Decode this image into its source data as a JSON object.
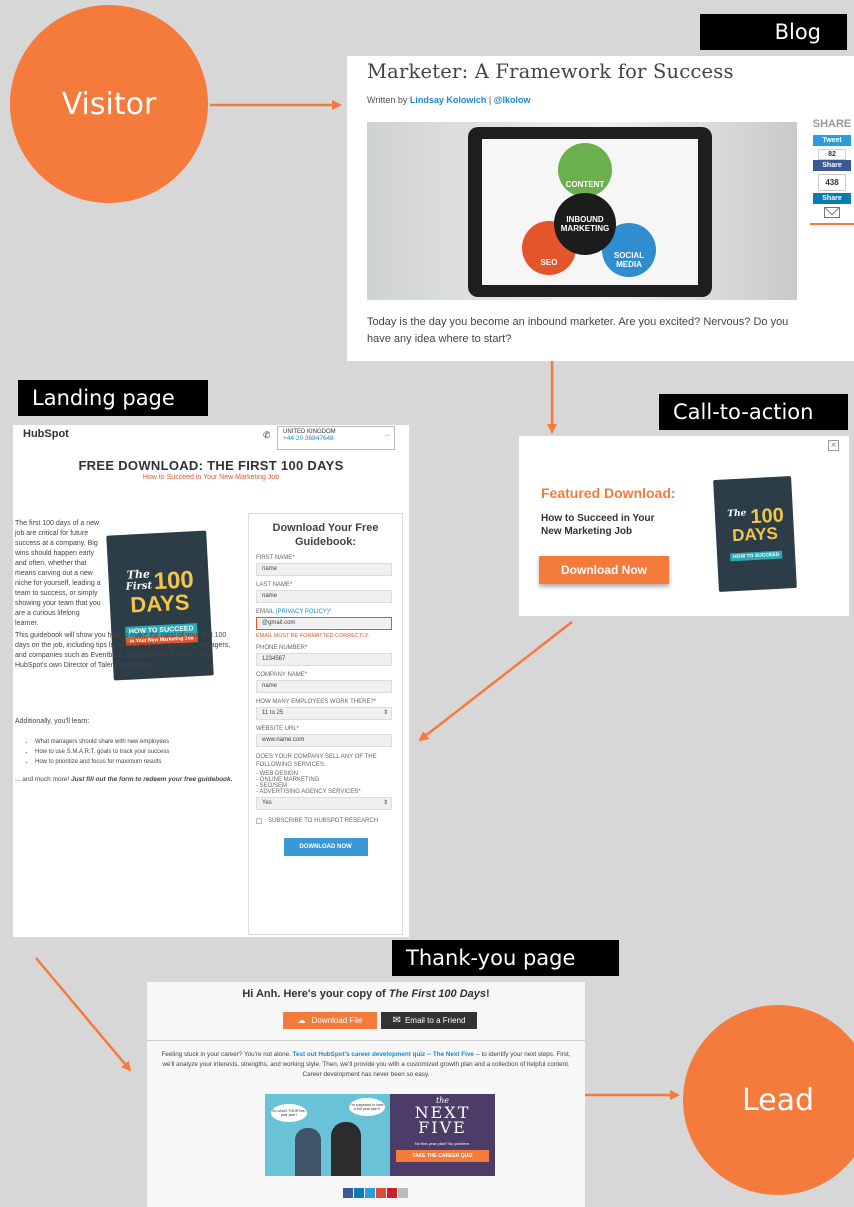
{
  "nodes": {
    "visitor": "Visitor",
    "lead": "Lead"
  },
  "labels": {
    "blog": "Blog",
    "landing": "Landing page",
    "cta": "Call-to-action",
    "thankyou": "Thank-you page"
  },
  "blog": {
    "title": "Marketer: A Framework for Success",
    "byline_prefix": "Written by ",
    "author": "Lindsay Kolowich",
    "separator": " | ",
    "handle": "@lkolow",
    "venn": {
      "content": "CONTENT",
      "center": "INBOUND MARKETING",
      "seo": "SEO",
      "social": "SOCIAL MEDIA"
    },
    "share": {
      "label": "SHARE",
      "tweet": "Tweet",
      "fb_count": "82",
      "fb": "Share",
      "count": "438",
      "in": "Share"
    },
    "body": "Today is the day you become an inbound marketer. Are you excited? Nervous? Do you have any idea where to start?"
  },
  "landing": {
    "logo": "HubSpot",
    "country": "UNITED KINGDOM",
    "phone": "+44 20 36847648",
    "title": "FREE DOWNLOAD: THE FIRST 100 DAYS",
    "subtitle": "How to Succeed in Your New Marketing Job",
    "p1": "The first 100 days of a new job are critical for future success at a company. Big wins should happen early and often, whether that means carving out a new niche for yourself, leading a team to success, or simply showing your team that you are a curious lifelong learner.",
    "p2": "This guidebook will show you how to make the most of your first 100 days on the job, including tips from successful employees, managers, and companies such as Eventbrite, Twitter EMEA & APAC, and HubSpot's own Director of Talent and Culture.",
    "p3": "Additionally, you'll learn:",
    "bullets": [
      "What managers should share with new employees",
      "How to use S.M.A.R.T. goals to track your success",
      "How to prioritize and focus for maximum results"
    ],
    "more_prefix": "... and much more! ",
    "more_bold": "Just fill out the form to redeem your free guidebook.",
    "book": {
      "the": "The",
      "first": "First",
      "num": "100",
      "days": "DAYS",
      "how": "HOW TO SUCCEED",
      "job": "in Your New Marketing Job"
    },
    "form": {
      "title": "Download Your Free Guidebook:",
      "first_label": "FIRST NAME*",
      "first_value": "name",
      "last_label": "LAST NAME*",
      "last_value": "name",
      "email_label": "EMAIL ",
      "privacy": "(PRIVACY POLICY)",
      "email_star": "*",
      "email_value": "@gmail.com",
      "email_error": "EMAIL MUST BE FORMATTED CORRECTLY.",
      "phone_label": "PHONE NUMBER*",
      "phone_value": "1234567",
      "company_label": "COMPANY NAME*",
      "company_value": "name",
      "employees_label": "HOW MANY EMPLOYEES WORK THERE?*",
      "employees_value": "11 to 25",
      "website_label": "WEBSITE URL*",
      "website_value": "www.name.com",
      "services_q": "DOES YOUR COMPANY SELL ANY OF THE FOLLOWING SERVICES:",
      "services": [
        "- WEB DESIGN",
        "- ONLINE MARKETING",
        "- SEO/SEM",
        "- ADVERTISING AGENCY SERVICES*"
      ],
      "services_value": "Yes",
      "subscribe": "SUBSCRIBE TO HUBSPOT RESEARCH",
      "submit": "DOWNLOAD NOW"
    }
  },
  "cta": {
    "close": "×",
    "heading": "Featured Download:",
    "line1": "How to Succeed in Your",
    "line2": "New Marketing Job",
    "button": "Download Now"
  },
  "thankyou": {
    "greeting": "Hi Anh. Here's your copy of ",
    "book": "The First 100 Days",
    "excl": "!",
    "download": "Download File",
    "email": "Email to a Friend",
    "p_a": "Feeling stuck in your career? You're not alone. ",
    "p_link": "Test out HubSpot's career development quiz -- The Next Five",
    "p_b": " -- to identify your next steps. First, we'll analyze your interests, strengths, and working style. Then, we'll provide you with a customized growth plan and a collection of helpful content. Career development has never been so easy.",
    "bubble1": "So what's YOUR five-year plan?",
    "bubble2": "I'm supposed to have a five year plan?!",
    "next_the": "the",
    "next_next": "NEXT",
    "next_five": "FIVE",
    "next_sub": "No five-year plan? No problem.",
    "quiz": "TAKE THE CAREER QUIZ"
  },
  "colors": {
    "orange": "#f47b3b",
    "black": "#000000",
    "blue": "#3b98d6",
    "dark": "#333333"
  }
}
